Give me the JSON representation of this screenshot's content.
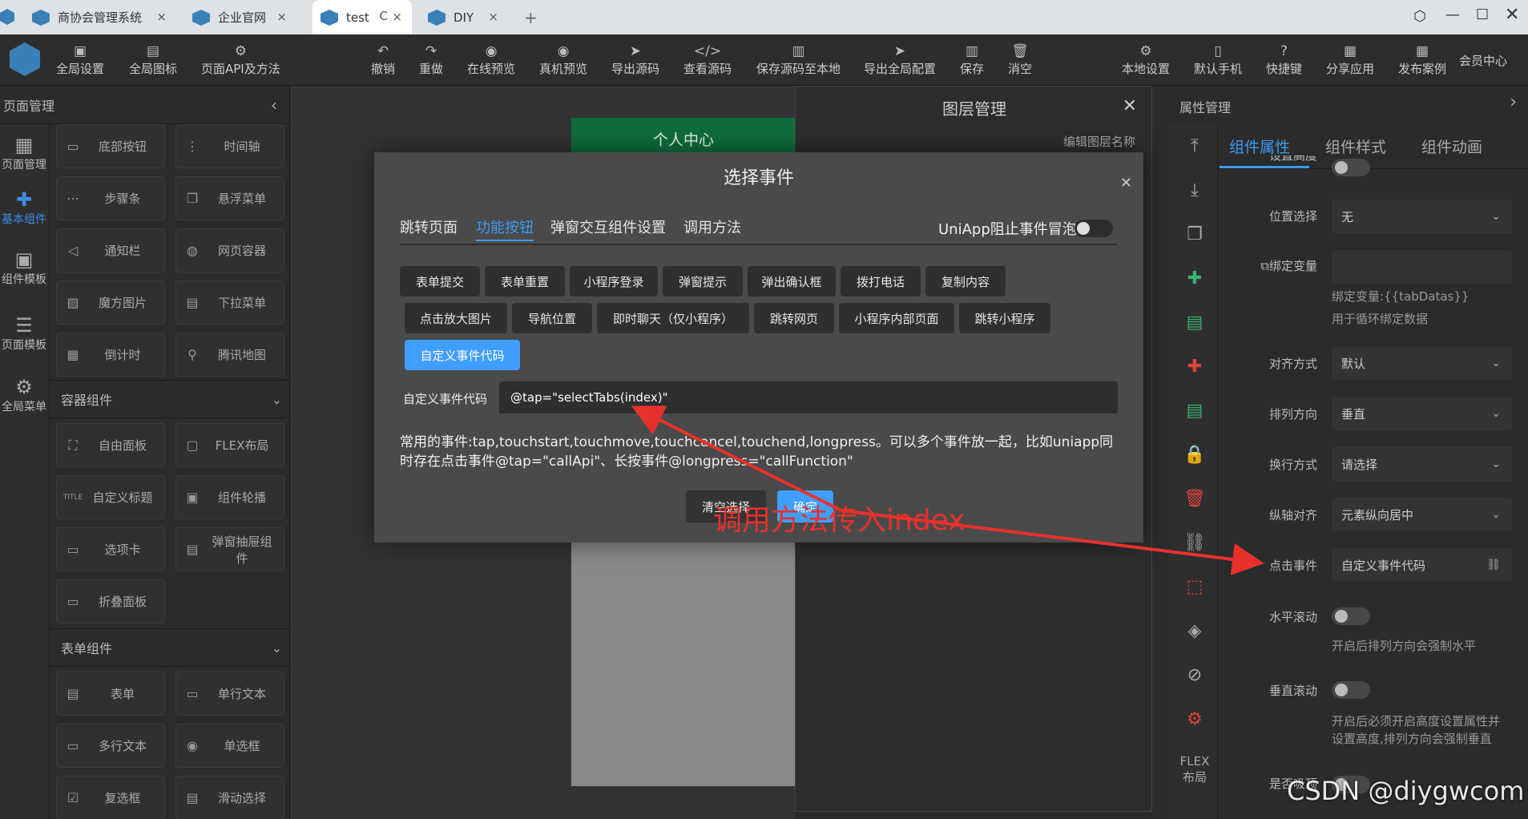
{
  "tabs": [
    {
      "label": "商协会管理系统",
      "close": "×"
    },
    {
      "label": "企业官网",
      "close": "×"
    },
    {
      "label": "test",
      "close": "×",
      "reload": "C"
    },
    {
      "label": "DIY",
      "close": "×"
    }
  ],
  "new_tab": "+",
  "toolbar": {
    "left": [
      {
        "label": "全局设置",
        "icon": "settings-icon"
      },
      {
        "label": "全局图标",
        "icon": "image-icon"
      },
      {
        "label": "页面API及方法",
        "icon": "api-icon"
      }
    ],
    "center": [
      {
        "label": "撤销"
      },
      {
        "label": "重做"
      },
      {
        "label": "在线预览"
      },
      {
        "label": "真机预览"
      },
      {
        "label": "导出源码"
      },
      {
        "label": "查看源码"
      },
      {
        "label": "保存源码至本地"
      },
      {
        "label": "导出全局配置"
      },
      {
        "label": "保存"
      },
      {
        "label": "消空"
      }
    ],
    "right": [
      {
        "label": "本地设置"
      },
      {
        "label": "默认手机"
      },
      {
        "label": "快捷键"
      },
      {
        "label": "分享应用"
      },
      {
        "label": "发布案例"
      }
    ],
    "member": "会员中心"
  },
  "left_panel": {
    "title": "页面管理",
    "nav": [
      {
        "label": "页面管理"
      },
      {
        "label": "基本组件"
      },
      {
        "label": "组件模板"
      },
      {
        "label": "页面模板"
      },
      {
        "label": "全局菜单"
      }
    ],
    "basic_items": [
      "底部按钮",
      "时间轴",
      "步骤条",
      "悬浮菜单",
      "通知栏",
      "网页容器",
      "魔方图片",
      "下拉菜单",
      "倒计时",
      "腾讯地图"
    ],
    "container_title": "容器组件",
    "container_items": [
      "自由面板",
      "FLEX布局",
      "自定义标题",
      "组件轮播",
      "选项卡",
      "弹窗抽屉组件",
      "折叠面板"
    ],
    "form_title": "表单组件",
    "form_items": [
      "表单",
      "单行文本",
      "多行文本",
      "单选框",
      "复选框",
      "滑动选择"
    ]
  },
  "phone": {
    "header": "个人中心"
  },
  "layer_panel": {
    "title": "图层管理",
    "sub": "编辑图层名称"
  },
  "modal": {
    "title": "选择事件",
    "tabs": [
      "跳转页面",
      "功能按钮",
      "弹窗交互组件设置",
      "调用方法"
    ],
    "active_tab": 1,
    "stop_bubble": "UniApp阻止事件冒泡",
    "buttons_row1": [
      "表单提交",
      "表单重置",
      "小程序登录",
      "弹窗提示",
      "弹出确认框",
      "拨打电话",
      "复制内容"
    ],
    "buttons_row2": [
      "点击放大图片",
      "导航位置",
      "即时聊天（仅小程序）",
      "跳转网页",
      "小程序内部页面",
      "跳转小程序"
    ],
    "buttons_row3": [
      "自定义事件代码"
    ],
    "code_label": "自定义事件代码",
    "code_value": "@tap=\"selectTabs(index)\"",
    "help": "常用的事件:tap,touchstart,touchmove,touchcancel,touchend,longpress。可以多个事件放一起，比如uniapp同时存在点击事件@tap=\"callApi\"、长按事件@longpress=\"callFunction\"",
    "clear": "清空选择",
    "confirm": "确定"
  },
  "annotation": "调用方法传入index",
  "right_panel": {
    "title": "属性管理",
    "tabs": [
      "组件属性",
      "组件样式",
      "组件动画"
    ],
    "flex": "FLEX\n布局",
    "props": {
      "cut_label": "设置高度",
      "position_label": "位置选择",
      "position_value": "无",
      "bind_label": "绑定变量",
      "bind_hint1": "绑定变量:{{tabDatas}}",
      "bind_hint2": "用于循环绑定数据",
      "align_label": "对齐方式",
      "align_value": "默认",
      "dir_label": "排列方向",
      "dir_value": "垂直",
      "wrap_label": "换行方式",
      "wrap_value": "请选择",
      "valign_label": "纵轴对齐",
      "valign_value": "元素纵向居中",
      "click_label": "点击事件",
      "click_value": "自定义事件代码",
      "hscroll_label": "水平滚动",
      "hscroll_hint": "开启后排列方向会强制水平",
      "vscroll_label": "垂直滚动",
      "vscroll_hint1": "开启后必须开启高度设置属性并",
      "vscroll_hint2": "设置高度,排列方向会强制垂直",
      "bottom_label": "是否吸顶"
    }
  },
  "watermark": "CSDN @diygwcom",
  "colors": {
    "accent": "#409eff",
    "annotation": "#e8312d",
    "header_green": "#0f6e3b"
  }
}
